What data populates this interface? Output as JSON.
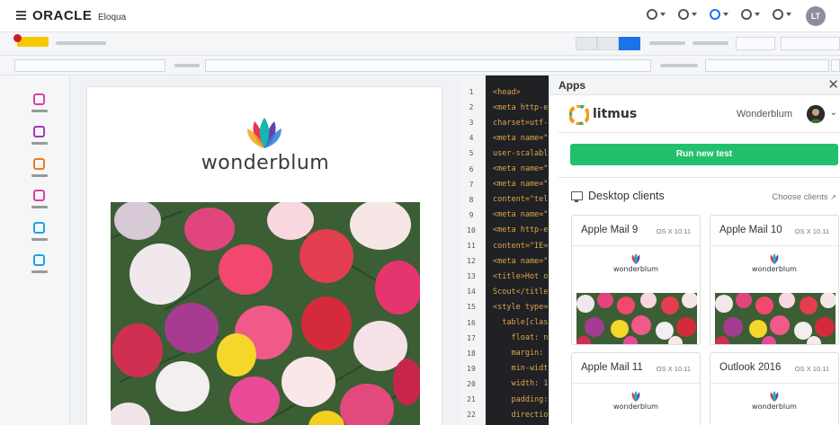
{
  "header": {
    "brand": "ORACLE",
    "product": "Eloqua",
    "avatar_initials": "LT"
  },
  "email": {
    "brand_name": "wonderblum"
  },
  "code_editor": {
    "lines": [
      {
        "n": "1",
        "code": "<head>"
      },
      {
        "n": "2",
        "code": "<meta http-e"
      },
      {
        "n": "3",
        "code": "charset=utf-"
      },
      {
        "n": "4",
        "code": "<meta name=\""
      },
      {
        "n": "5",
        "code": "user-scalabl"
      },
      {
        "n": "6",
        "code": "<meta name=\""
      },
      {
        "n": "7",
        "code": "<meta name=\""
      },
      {
        "n": "8",
        "code": "content=\"tel"
      },
      {
        "n": "9",
        "code": "<meta name=\""
      },
      {
        "n": "10",
        "code": "<meta http-e"
      },
      {
        "n": "11",
        "code": "content=\"IE="
      },
      {
        "n": "12",
        "code": "<meta name=\""
      },
      {
        "n": "13",
        "code": "<title>Hot o"
      },
      {
        "n": "14",
        "code": "Scout</title"
      },
      {
        "n": "15",
        "code": "<style type="
      },
      {
        "n": "16",
        "code": "  table[clas"
      },
      {
        "n": "17",
        "code": "    float: n"
      },
      {
        "n": "18",
        "code": "    margin: "
      },
      {
        "n": "19",
        "code": "    min-widt"
      },
      {
        "n": "20",
        "code": "    width: 1"
      },
      {
        "n": "21",
        "code": "    padding:"
      },
      {
        "n": "22",
        "code": "    directio"
      }
    ]
  },
  "apps_panel": {
    "title": "Apps",
    "app_name": "litmus",
    "account": "Wonderblum",
    "run_button": "Run new test",
    "section_title": "Desktop clients",
    "choose_link": "Choose clients",
    "clients": [
      {
        "name": "Apple Mail 9",
        "os": "OS X 10.11",
        "brand": "wonderblum"
      },
      {
        "name": "Apple Mail 10",
        "os": "OS X 10.11",
        "brand": "wonderblum"
      },
      {
        "name": "Apple Mail 11",
        "os": "OS X 10.11",
        "brand": "wonderblum"
      },
      {
        "name": "Outlook 2016",
        "os": "OS X 10.11",
        "brand": "wonderblum"
      }
    ]
  },
  "colors": {
    "accent_blue": "#1a73e8",
    "run_green": "#22c06d",
    "rail_icons": [
      "#e040a0",
      "#a23bb5",
      "#f07a1c",
      "#e040a0",
      "#1fa2e6",
      "#1fa2e6"
    ]
  }
}
